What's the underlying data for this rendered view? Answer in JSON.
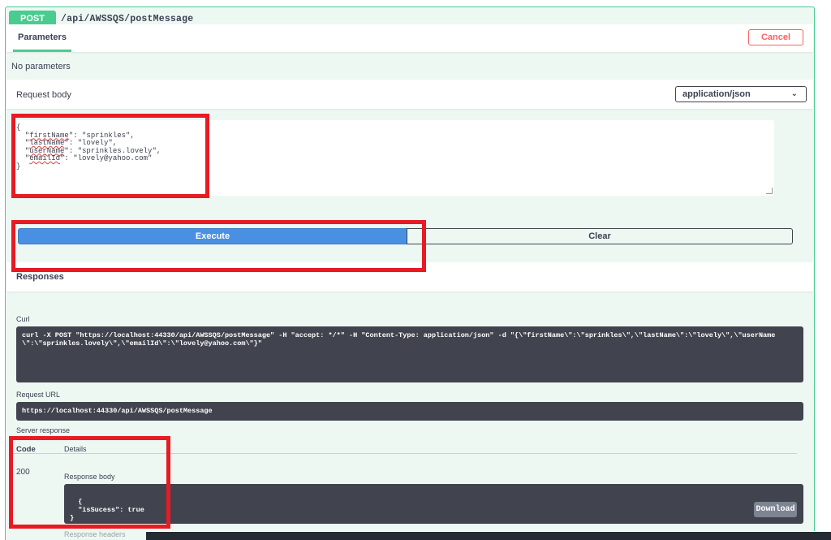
{
  "operation": {
    "method": "POST",
    "path": "/api/AWSSQS/postMessage"
  },
  "parameters": {
    "tab_label": "Parameters",
    "cancel_label": "Cancel",
    "empty_text": "No parameters"
  },
  "request_body": {
    "label": "Request body",
    "content_type": "application/json",
    "json_lines": {
      "open": "{",
      "k1": "firstName",
      "v1": ": \"sprinkles\",",
      "k2": "lastName",
      "v2": ": \"lovely\",",
      "k3": "userName",
      "v3": ": \"sprinkles.lovely\",",
      "k4": "emailId",
      "v4": ": \"lovely@yahoo.com\"",
      "close": "}"
    }
  },
  "actions": {
    "execute_label": "Execute",
    "clear_label": "Clear"
  },
  "responses": {
    "title": "Responses",
    "curl_label": "Curl",
    "curl_command": "curl -X POST \"https://localhost:44330/api/AWSSQS/postMessage\" -H \"accept: */*\" -H \"Content-Type: application/json\" -d \"{\\\"firstName\\\":\\\"sprinkles\\\",\\\"lastName\\\":\\\"lovely\\\",\\\"userName\\\":\\\"sprinkles.lovely\\\",\\\"emailId\\\":\\\"lovely@yahoo.com\\\"}\"",
    "request_url_label": "Request URL",
    "request_url": "https://localhost:44330/api/AWSSQS/postMessage",
    "server_response_label": "Server response",
    "code_header": "Code",
    "details_header": "Details",
    "status_code": "200",
    "response_body_label": "Response body",
    "response_body": "{\n  \"isSucess\": true\n}",
    "download_label": "Download",
    "response_headers_label": "Response headers"
  },
  "colors": {
    "post_accent": "#49cc90",
    "execute_blue": "#4990e2",
    "cancel_red": "#ff6060",
    "highlight_red": "#e81a23",
    "code_bg": "#41444e"
  }
}
